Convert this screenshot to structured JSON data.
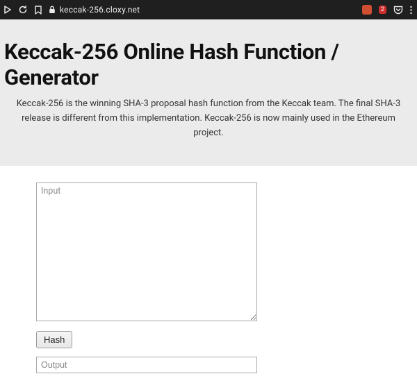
{
  "browser": {
    "url": "keccak-256.cloxy.net",
    "notification_count": "2"
  },
  "hero": {
    "title": "Keccak-256 Online Hash Function / Generator",
    "description": "Keccak-256 is the winning SHA-3 proposal hash function from the Keccak team. The final SHA-3 release is different from this implementation. Keccak-256 is now mainly used in the Ethereum project."
  },
  "form": {
    "input_placeholder": "Input",
    "input_value": "",
    "hash_button_label": "Hash",
    "output_placeholder": "Output",
    "output_value": ""
  }
}
